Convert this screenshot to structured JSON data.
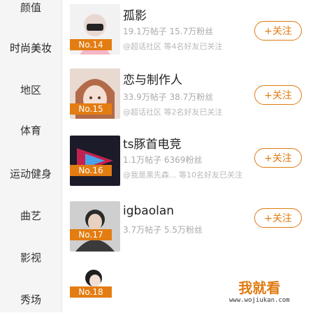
{
  "sidebar": {
    "items": [
      "颜值",
      "时尚美妆",
      "地区",
      "体育",
      "运动健身",
      "曲艺",
      "影视",
      "秀场"
    ]
  },
  "rows": [
    {
      "name": "孤影",
      "stat": "19.1万帖子 15.7万粉丝",
      "sub": "@超话社区 等4名好友已关注",
      "rank": "No.14",
      "follow": "+关注"
    },
    {
      "name": "恋与制作人",
      "stat": "33.9万帖子 38.7万粉丝",
      "sub": "@超话社区 等2名好友已关注",
      "rank": "No.15",
      "follow": "+关注"
    },
    {
      "name": "ts豚首电竞",
      "stat": "1.1万帖子 6369粉丝",
      "sub": "@我是黑先森... 等10名好友已关注",
      "rank": "No.16",
      "follow": "+关注"
    },
    {
      "name": "igbaolan",
      "stat": "3.7万帖子 5.5万粉丝",
      "sub": "",
      "rank": "No.17",
      "follow": "+关注"
    },
    {
      "name": "",
      "stat": "",
      "sub": "",
      "rank": "No.18",
      "follow": ""
    }
  ],
  "watermark": {
    "title": "我就看",
    "url": "www.wojiukan.com"
  }
}
